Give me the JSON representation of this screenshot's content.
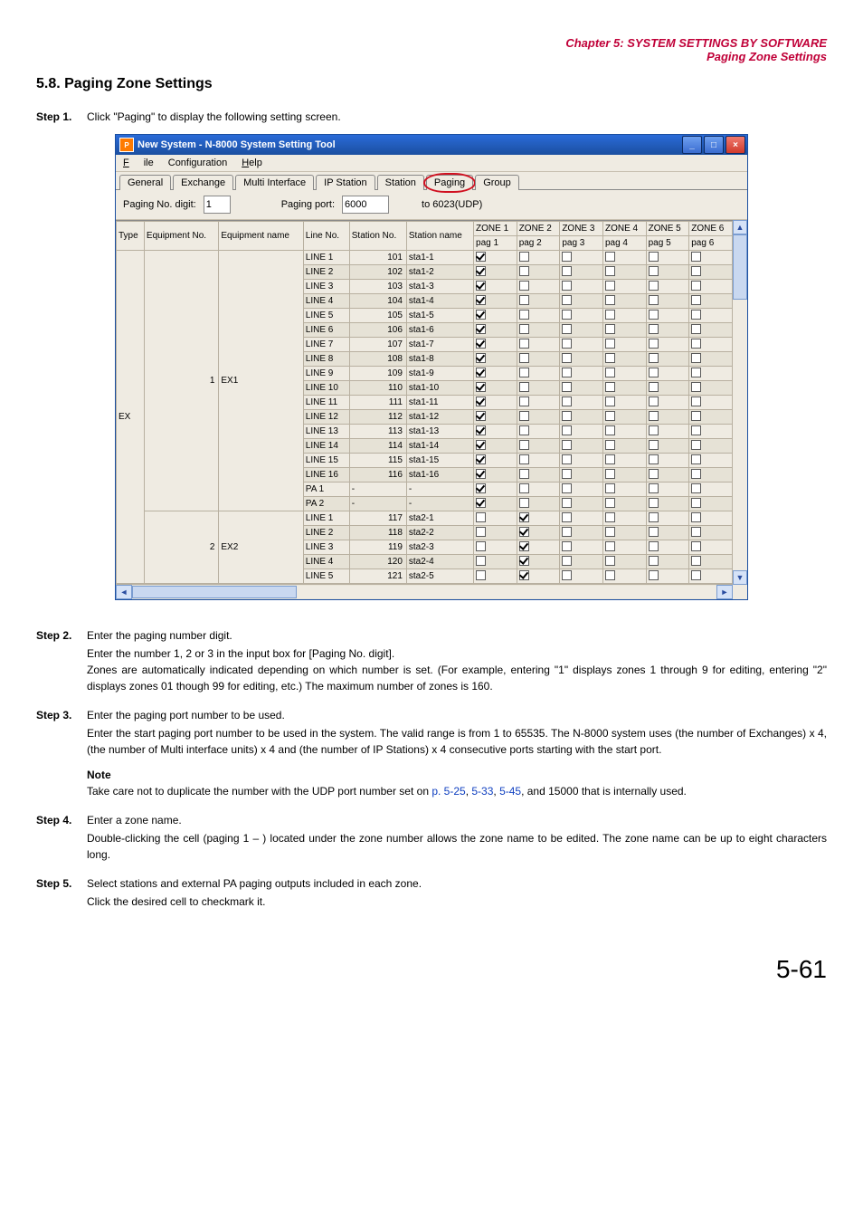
{
  "header": {
    "chapter": "Chapter 5:  SYSTEM SETTINGS BY SOFTWARE",
    "subtitle": "Paging Zone Settings"
  },
  "section_title": "5.8. Paging Zone Settings",
  "steps": {
    "s1": {
      "label": "Step 1.",
      "title": "Click \"Paging\" to display the following setting screen."
    },
    "s2": {
      "label": "Step 2.",
      "title": "Enter the paging number digit.",
      "body": "Enter the number 1, 2 or 3 in the input box for [Paging No. digit].\nZones are automatically indicated depending on which number is set. (For example, entering \"1\" displays zones 1 through 9 for editing, entering \"2\" displays zones 01 though 99 for editing, etc.) The maximum number of zones is 160."
    },
    "s3": {
      "label": "Step 3.",
      "title": "Enter the paging port number to be used.",
      "body": "Enter the start paging port number to be used in the system. The valid range is from 1 to 65535. The N-8000 system uses (the number of Exchanges) x 4, (the number of Multi interface units) x 4 and (the number of IP Stations) x 4 consecutive ports starting with the start port.",
      "note_label": "Note",
      "note_body_a": "Take care not to duplicate the number with the UDP port number set on ",
      "note_ref1": "p. 5-25",
      "note_sep1": ", ",
      "note_ref2": "5-33",
      "note_sep2": ", ",
      "note_ref3": "5-45",
      "note_body_b": ", and 15000 that is internally used."
    },
    "s4": {
      "label": "Step 4.",
      "title": "Enter a zone name.",
      "body": "Double-clicking the cell (paging 1 – ) located under the zone number allows the zone name to be edited. The zone name can be up to eight characters long."
    },
    "s5": {
      "label": "Step 5.",
      "title": "Select stations and external PA paging outputs included in each zone.",
      "body": "Click the desired cell to checkmark it."
    }
  },
  "page_number": "5-61",
  "window": {
    "title": "New System - N-8000 System Setting Tool",
    "menus": {
      "file": "File",
      "config": "Configuration",
      "help": "Help"
    },
    "tabs": [
      "General",
      "Exchange",
      "Multi Interface",
      "IP Station",
      "Station",
      "Paging",
      "Group"
    ],
    "params": {
      "digit_label": "Paging No. digit:",
      "digit_value": "1",
      "port_label": "Paging port:",
      "port_value": "6000",
      "to_label": "to 6023(UDP)"
    },
    "cols": {
      "type": "Type",
      "eqno": "Equipment No.",
      "eqname": "Equipment name",
      "lineno": "Line No.",
      "stano": "Station No.",
      "staname": "Station name",
      "z1a": "ZONE 1",
      "z1b": "pag 1",
      "z2a": "ZONE 2",
      "z2b": "pag 2",
      "z3a": "ZONE 3",
      "z3b": "pag 3",
      "z4a": "ZONE 4",
      "z4b": "pag 4",
      "z5a": "ZONE 5",
      "z5b": "pag 5",
      "z6a": "ZONE 6",
      "z6b": "pag 6"
    },
    "group1": {
      "type": "EX",
      "eqno": "1",
      "eqname": "EX1"
    },
    "group2": {
      "eqno": "2",
      "eqname": "EX2"
    },
    "rows1": [
      {
        "ln": "LINE 1",
        "sn": "101",
        "nm": "sta1-1"
      },
      {
        "ln": "LINE 2",
        "sn": "102",
        "nm": "sta1-2"
      },
      {
        "ln": "LINE 3",
        "sn": "103",
        "nm": "sta1-3"
      },
      {
        "ln": "LINE 4",
        "sn": "104",
        "nm": "sta1-4"
      },
      {
        "ln": "LINE 5",
        "sn": "105",
        "nm": "sta1-5"
      },
      {
        "ln": "LINE 6",
        "sn": "106",
        "nm": "sta1-6"
      },
      {
        "ln": "LINE 7",
        "sn": "107",
        "nm": "sta1-7"
      },
      {
        "ln": "LINE 8",
        "sn": "108",
        "nm": "sta1-8"
      },
      {
        "ln": "LINE 9",
        "sn": "109",
        "nm": "sta1-9"
      },
      {
        "ln": "LINE 10",
        "sn": "110",
        "nm": "sta1-10"
      },
      {
        "ln": "LINE 11",
        "sn": "111",
        "nm": "sta1-11"
      },
      {
        "ln": "LINE 12",
        "sn": "112",
        "nm": "sta1-12"
      },
      {
        "ln": "LINE 13",
        "sn": "113",
        "nm": "sta1-13"
      },
      {
        "ln": "LINE 14",
        "sn": "114",
        "nm": "sta1-14"
      },
      {
        "ln": "LINE 15",
        "sn": "115",
        "nm": "sta1-15"
      },
      {
        "ln": "LINE 16",
        "sn": "116",
        "nm": "sta1-16"
      },
      {
        "ln": "PA 1",
        "sn": "-",
        "nm": "-"
      },
      {
        "ln": "PA 2",
        "sn": "-",
        "nm": "-"
      }
    ],
    "rows2": [
      {
        "ln": "LINE 1",
        "sn": "117",
        "nm": "sta2-1"
      },
      {
        "ln": "LINE 2",
        "sn": "118",
        "nm": "sta2-2"
      },
      {
        "ln": "LINE 3",
        "sn": "119",
        "nm": "sta2-3"
      },
      {
        "ln": "LINE 4",
        "sn": "120",
        "nm": "sta2-4"
      },
      {
        "ln": "LINE 5",
        "sn": "121",
        "nm": "sta2-5"
      }
    ]
  }
}
